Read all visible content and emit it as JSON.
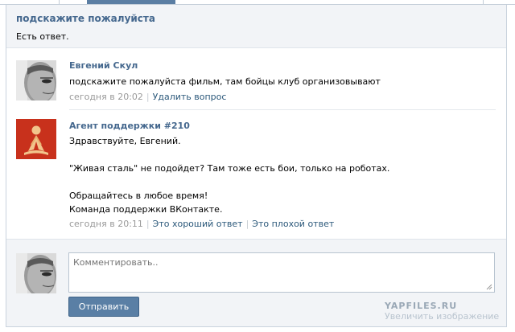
{
  "question": {
    "title": "подскажите пожалуйста",
    "status": "Есть ответ."
  },
  "messages": [
    {
      "author": "Евгений Скул",
      "lines": [
        "подскажите пожалуйста фильм, там бойцы клуб организовывают"
      ],
      "time": "сегодня в 20:02",
      "actions": [
        "Удалить вопрос"
      ]
    },
    {
      "author": "Агент поддержки #210",
      "lines": [
        "Здравствуйте, Евгений.",
        "\"Живая сталь\" не подойдет? Там тоже есть бои, только на роботах.",
        "Обращайтесь в любое время!",
        "Команда поддержки ВКонтакте."
      ],
      "time": "сегодня в 20:11",
      "actions": [
        "Это хороший ответ",
        "Это плохой ответ"
      ]
    }
  ],
  "reply": {
    "placeholder": "Комментировать..",
    "send_label": "Отправить"
  },
  "watermark": {
    "site": "YAPFILES.RU",
    "text": "Увеличить изображение"
  }
}
